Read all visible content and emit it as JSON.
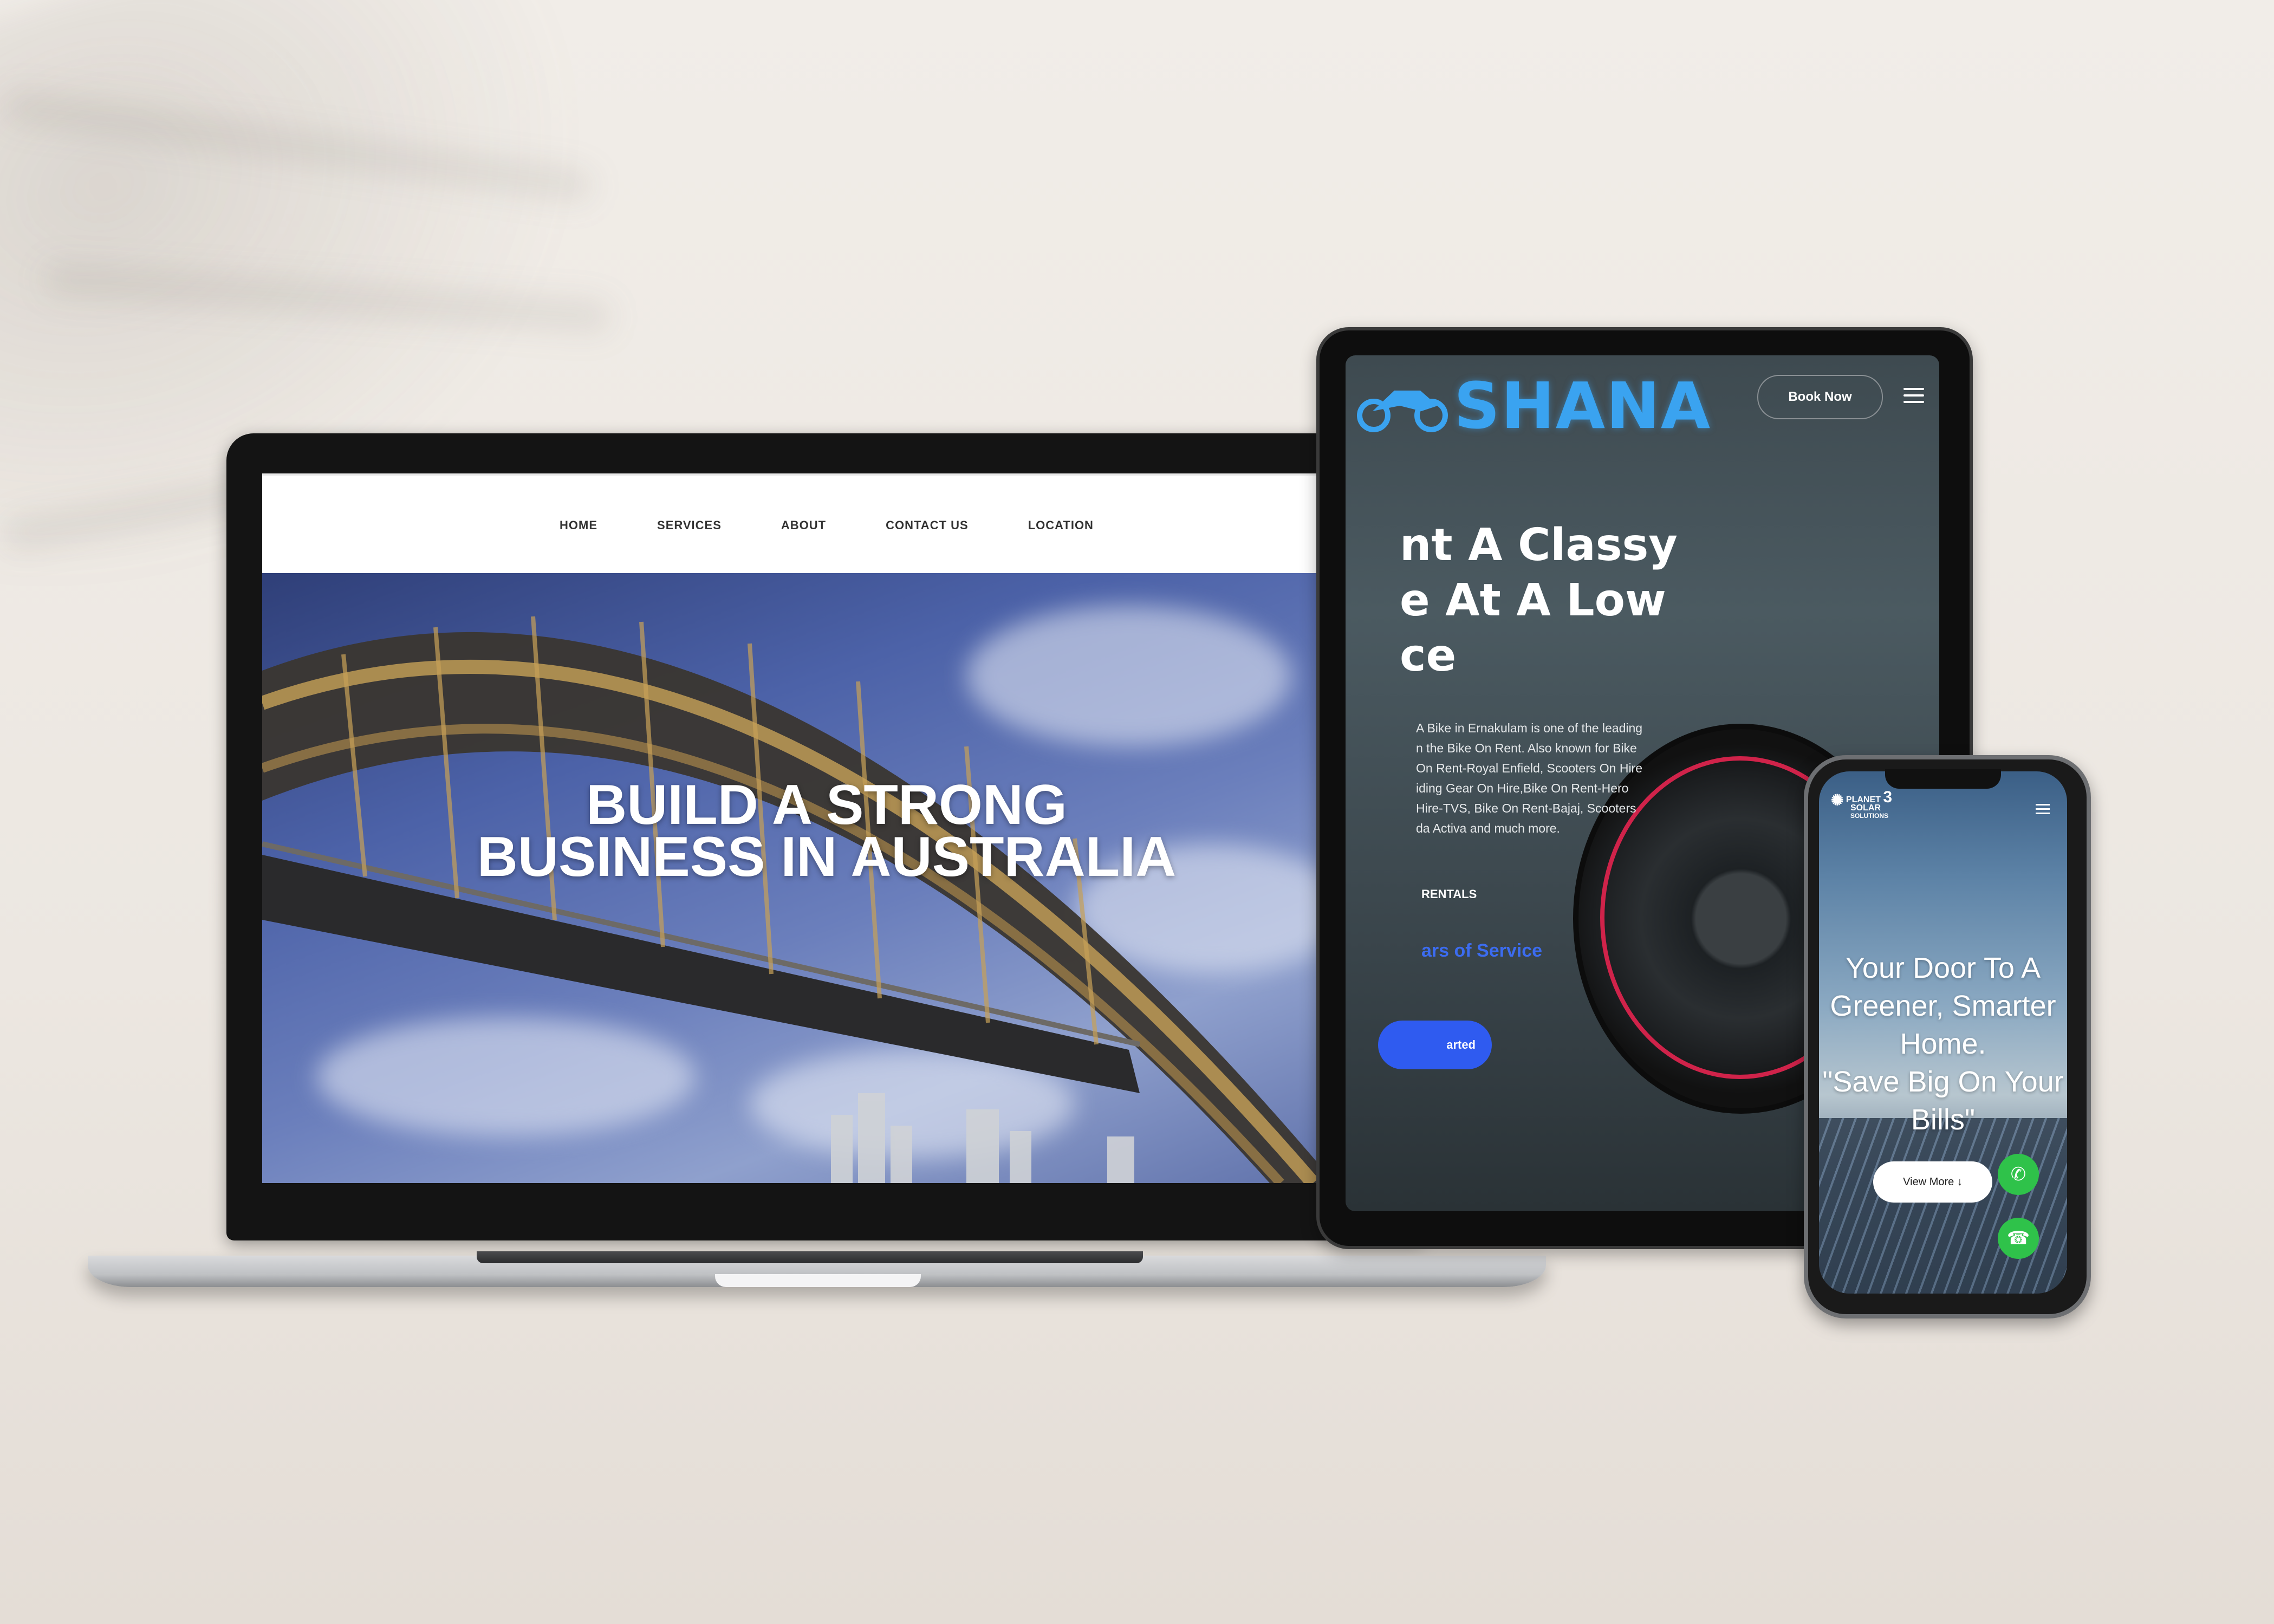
{
  "laptop": {
    "nav": [
      "HOME",
      "SERVICES",
      "ABOUT",
      "CONTACT US",
      "LOCATION"
    ],
    "hero_line1": "BUILD A STRONG",
    "hero_line2": "BUSINESS IN AUSTRALIA"
  },
  "tablet": {
    "logo": "SHANA",
    "book_button": "Book Now",
    "headline_1": "nt A Classy",
    "headline_2": "e At A Low",
    "headline_3": "ce",
    "paragraph_lines": [
      "A Bike in Ernakulam is one of the leading",
      "n the Bike On Rent. Also known for Bike",
      "On Rent-Royal Enfield, Scooters On Hire",
      "iding Gear On Hire,Bike On Rent-Hero",
      "Hire-TVS, Bike On Rent-Bajaj, Scooters",
      "da Activa and much more."
    ],
    "subheading": "RENTALS",
    "blue_text": "ars of Service",
    "cta_button": "arted"
  },
  "phone": {
    "logo_line1": "PLANET",
    "logo_line2": "SOLAR",
    "logo_line3": "SOLUTIONS",
    "logo_number": "3",
    "headline_1": "Your Door To A",
    "headline_2": "Greener, Smarter",
    "headline_3": "Home.",
    "headline_4": "\"Save Big On Your",
    "headline_5": "Bills\"",
    "view_more": "View More ↓"
  },
  "colors": {
    "tablet_logo": "#3aa3f0",
    "tablet_cta": "#2f5bf0",
    "phone_fab": "#2fc24a"
  }
}
